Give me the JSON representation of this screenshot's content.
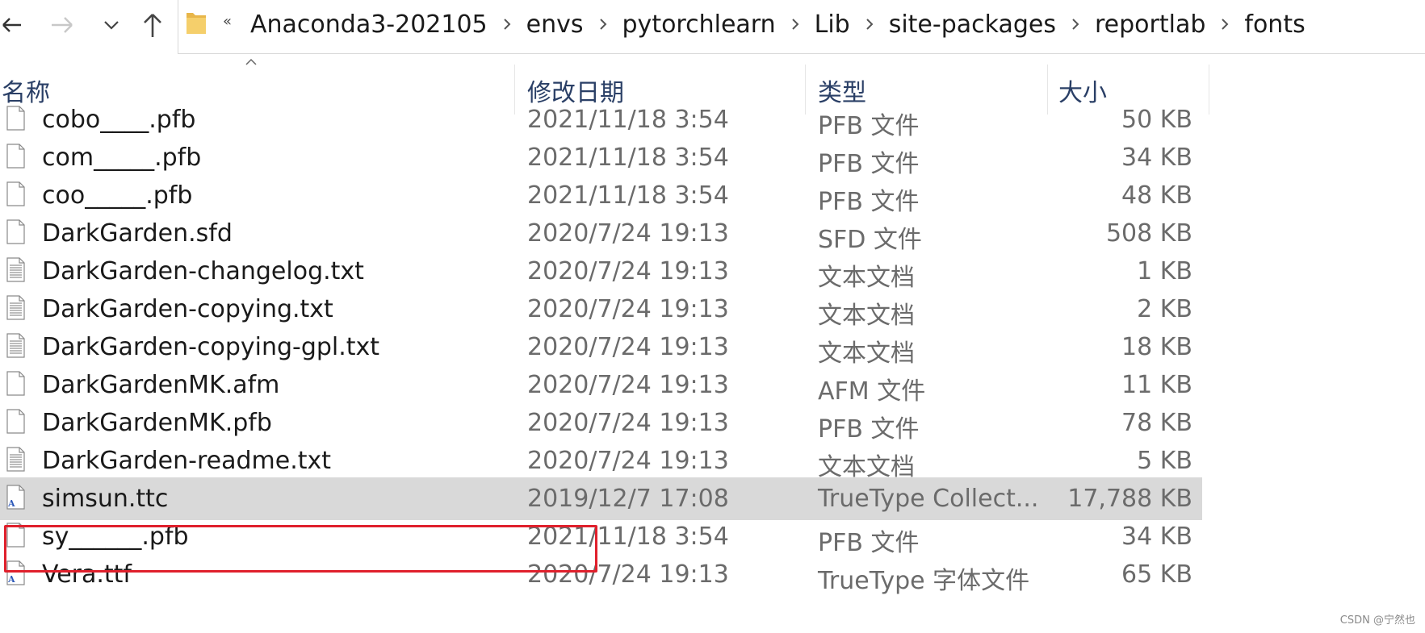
{
  "address_bar": {
    "overflow": "«",
    "breadcrumbs": [
      "Anaconda3-202105",
      "envs",
      "pytorchlearn",
      "Lib",
      "site-packages",
      "reportlab",
      "fonts"
    ]
  },
  "columns": {
    "name": "名称",
    "date": "修改日期",
    "type": "类型",
    "size": "大小"
  },
  "files": [
    {
      "name": "cobo____.pfb",
      "date": "2021/11/18 3:54",
      "type": "PFB 文件",
      "size": "50 KB",
      "icon": "blank-file-icon"
    },
    {
      "name": "com_____.pfb",
      "date": "2021/11/18 3:54",
      "type": "PFB 文件",
      "size": "34 KB",
      "icon": "blank-file-icon"
    },
    {
      "name": "coo_____.pfb",
      "date": "2021/11/18 3:54",
      "type": "PFB 文件",
      "size": "48 KB",
      "icon": "blank-file-icon"
    },
    {
      "name": "DarkGarden.sfd",
      "date": "2020/7/24 19:13",
      "type": "SFD 文件",
      "size": "508 KB",
      "icon": "blank-file-icon"
    },
    {
      "name": "DarkGarden-changelog.txt",
      "date": "2020/7/24 19:13",
      "type": "文本文档",
      "size": "1 KB",
      "icon": "text-file-icon"
    },
    {
      "name": "DarkGarden-copying.txt",
      "date": "2020/7/24 19:13",
      "type": "文本文档",
      "size": "2 KB",
      "icon": "text-file-icon"
    },
    {
      "name": "DarkGarden-copying-gpl.txt",
      "date": "2020/7/24 19:13",
      "type": "文本文档",
      "size": "18 KB",
      "icon": "text-file-icon"
    },
    {
      "name": "DarkGardenMK.afm",
      "date": "2020/7/24 19:13",
      "type": "AFM 文件",
      "size": "11 KB",
      "icon": "blank-file-icon"
    },
    {
      "name": "DarkGardenMK.pfb",
      "date": "2020/7/24 19:13",
      "type": "PFB 文件",
      "size": "78 KB",
      "icon": "blank-file-icon"
    },
    {
      "name": "DarkGarden-readme.txt",
      "date": "2020/7/24 19:13",
      "type": "文本文档",
      "size": "5 KB",
      "icon": "text-file-icon"
    },
    {
      "name": "simsun.ttc",
      "date": "2019/12/7 17:08",
      "type": "TrueType Collect...",
      "size": "17,788 KB",
      "icon": "font-file-icon",
      "selected": true
    },
    {
      "name": "sy______.pfb",
      "date": "2021/11/18 3:54",
      "type": "PFB 文件",
      "size": "34 KB",
      "icon": "blank-file-icon"
    },
    {
      "name": "Vera.ttf",
      "date": "2020/7/24 19:13",
      "type": "TrueType 字体文件",
      "size": "65 KB",
      "icon": "font-file-icon"
    }
  ],
  "watermark": "CSDN @宁然也",
  "colors": {
    "selection": "#d9d9d9",
    "highlight_border": "#e0202c",
    "header_text": "#2a3f66",
    "folder": "#e8b64a"
  }
}
